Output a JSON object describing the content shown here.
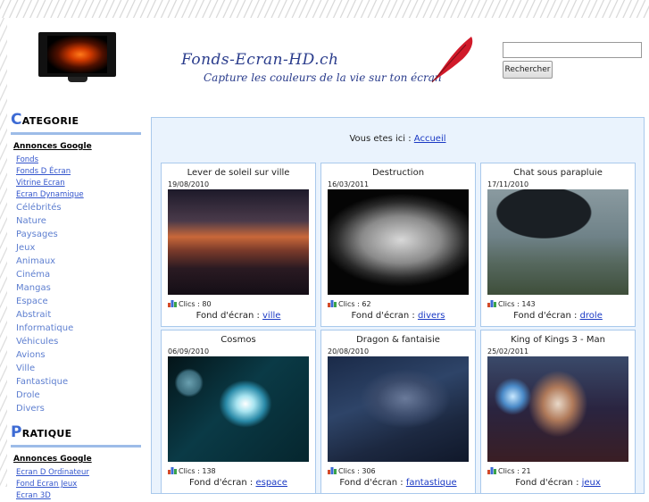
{
  "header": {
    "logo_title": "Fonds-Ecran-HD.ch",
    "logo_tagline": "Capture les couleurs de la vie sur ton écran",
    "search_value": "",
    "search_button": "Rechercher"
  },
  "sidebar": {
    "categorie_cap": "C",
    "categorie_rest": "ATEGORIE",
    "ads1_label": "Annonces Google",
    "ads1_links": [
      "Fonds",
      "Fonds D Écran",
      "Vitrine Ecran",
      "Ecran Dynamique"
    ],
    "categories": [
      "Célébrités",
      "Nature",
      "Paysages",
      "Jeux",
      "Animaux",
      "Cinéma",
      "Mangas",
      "Espace",
      "Abstrait",
      "Informatique",
      "Véhicules",
      "Avions",
      "Ville",
      "Fantastique",
      "Drole",
      "Divers"
    ],
    "pratique_cap": "P",
    "pratique_rest": "RATIQUE",
    "ads2_label": "Annonces Google",
    "ads2_links": [
      "Ecran D Ordinateur",
      "Fond Ecran Jeux",
      "Ecran 3D"
    ]
  },
  "breadcrumb": {
    "prefix": "Vous etes ici : ",
    "link": "Accueil"
  },
  "wallpapers": [
    {
      "title": "Lever de soleil sur ville",
      "date": "19/08/2010",
      "clicks": "Clics : 80",
      "cat_prefix": "Fond d'écran : ",
      "category": "ville"
    },
    {
      "title": "Destruction",
      "date": "16/03/2011",
      "clicks": "Clics : 62",
      "cat_prefix": "Fond d'écran : ",
      "category": "divers"
    },
    {
      "title": "Chat sous parapluie",
      "date": "17/11/2010",
      "clicks": "Clics : 143",
      "cat_prefix": "Fond d'écran : ",
      "category": "drole"
    },
    {
      "title": "Cosmos",
      "date": "06/09/2010",
      "clicks": "Clics : 138",
      "cat_prefix": "Fond d'écran : ",
      "category": "espace"
    },
    {
      "title": "Dragon & fantaisie",
      "date": "20/08/2010",
      "clicks": "Clics : 306",
      "cat_prefix": "Fond d'écran : ",
      "category": "fantastique"
    },
    {
      "title": "King of Kings 3 - Man",
      "date": "25/02/2011",
      "clicks": "Clics : 21",
      "cat_prefix": "Fond d'écran : ",
      "category": "jeux"
    }
  ],
  "colors": {
    "link": "#1a39c4",
    "sidebar_link": "#5e7fd0",
    "panel_bg": "#eaf3fd",
    "panel_border": "#a9c9ec",
    "heading_accent": "#3d6bd4"
  }
}
